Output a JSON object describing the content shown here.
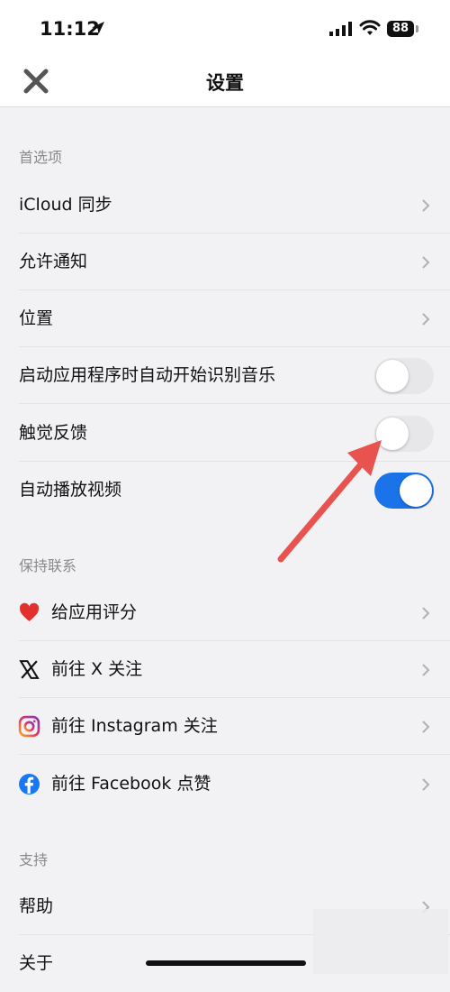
{
  "status_bar": {
    "time": "11:12",
    "battery": "88"
  },
  "nav": {
    "title": "设置"
  },
  "sections": [
    {
      "header": "首选项"
    },
    {
      "header": "保持联系"
    },
    {
      "header": "支持"
    }
  ],
  "rows": {
    "icloud": "iCloud 同步",
    "notify": "允许通知",
    "location": "位置",
    "auto_recognize": "启动应用程序时自动开始识别音乐",
    "haptics": "触觉反馈",
    "autoplay": "自动播放视频",
    "rate": "给应用评分",
    "x": "前往 X 关注",
    "instagram": "前往 Instagram 关注",
    "facebook": "前往 Facebook 点赞",
    "help": "帮助",
    "about": "关于"
  },
  "toggles": {
    "auto_recognize": false,
    "haptics": false,
    "autoplay": true
  },
  "colors": {
    "accent": "#1a73e8",
    "annotation": "#e8524f",
    "heart": "#e0312f",
    "facebook": "#1877f2"
  }
}
